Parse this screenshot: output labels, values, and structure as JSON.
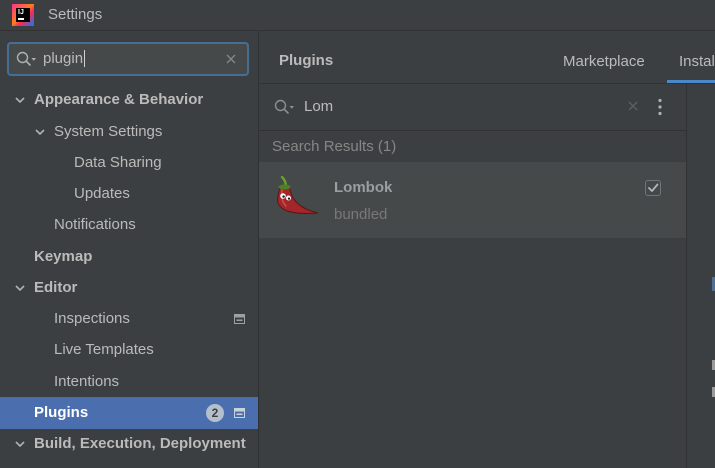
{
  "window": {
    "title": "Settings",
    "logo_text": "IJ",
    "logo_icon": "intellij-logo-icon"
  },
  "sidebar": {
    "search": {
      "value": "plugin",
      "icon": "search-icon",
      "clear_icon": "clear-icon"
    },
    "items": [
      {
        "label": "Appearance & Behavior",
        "expanded": true
      },
      {
        "label": "System Settings",
        "expanded": true
      },
      {
        "label": "Data Sharing"
      },
      {
        "label": "Updates"
      },
      {
        "label": "Notifications"
      },
      {
        "label": "Keymap"
      },
      {
        "label": "Editor",
        "expanded": true
      },
      {
        "label": "Inspections",
        "icon": "project-scope-icon"
      },
      {
        "label": "Live Templates"
      },
      {
        "label": "Intentions"
      },
      {
        "label": "Plugins",
        "selected": true,
        "badge": "2",
        "icon": "project-scope-icon"
      },
      {
        "label": "Build, Execution, Deployment",
        "expanded": true
      }
    ]
  },
  "main": {
    "title": "Plugins",
    "tabs": [
      {
        "label": "Marketplace",
        "active": false
      },
      {
        "label": "Instal",
        "active": true
      }
    ],
    "search": {
      "value": "Lom",
      "icon": "search-icon",
      "clear_icon": "clear-icon",
      "menu_icon": "more-vertical-icon"
    },
    "results_header": "Search Results (1)",
    "plugins": [
      {
        "name": "Lombok",
        "source": "bundled",
        "enabled": true,
        "icon": "chili-pepper-icon"
      }
    ]
  },
  "colors": {
    "background": "#3c3f41",
    "selection": "#4b6eaf",
    "tab_underline": "#4a88c7",
    "focus_border": "#466d94",
    "text": "#bbbbbb",
    "plugin_row": "#45494a"
  }
}
